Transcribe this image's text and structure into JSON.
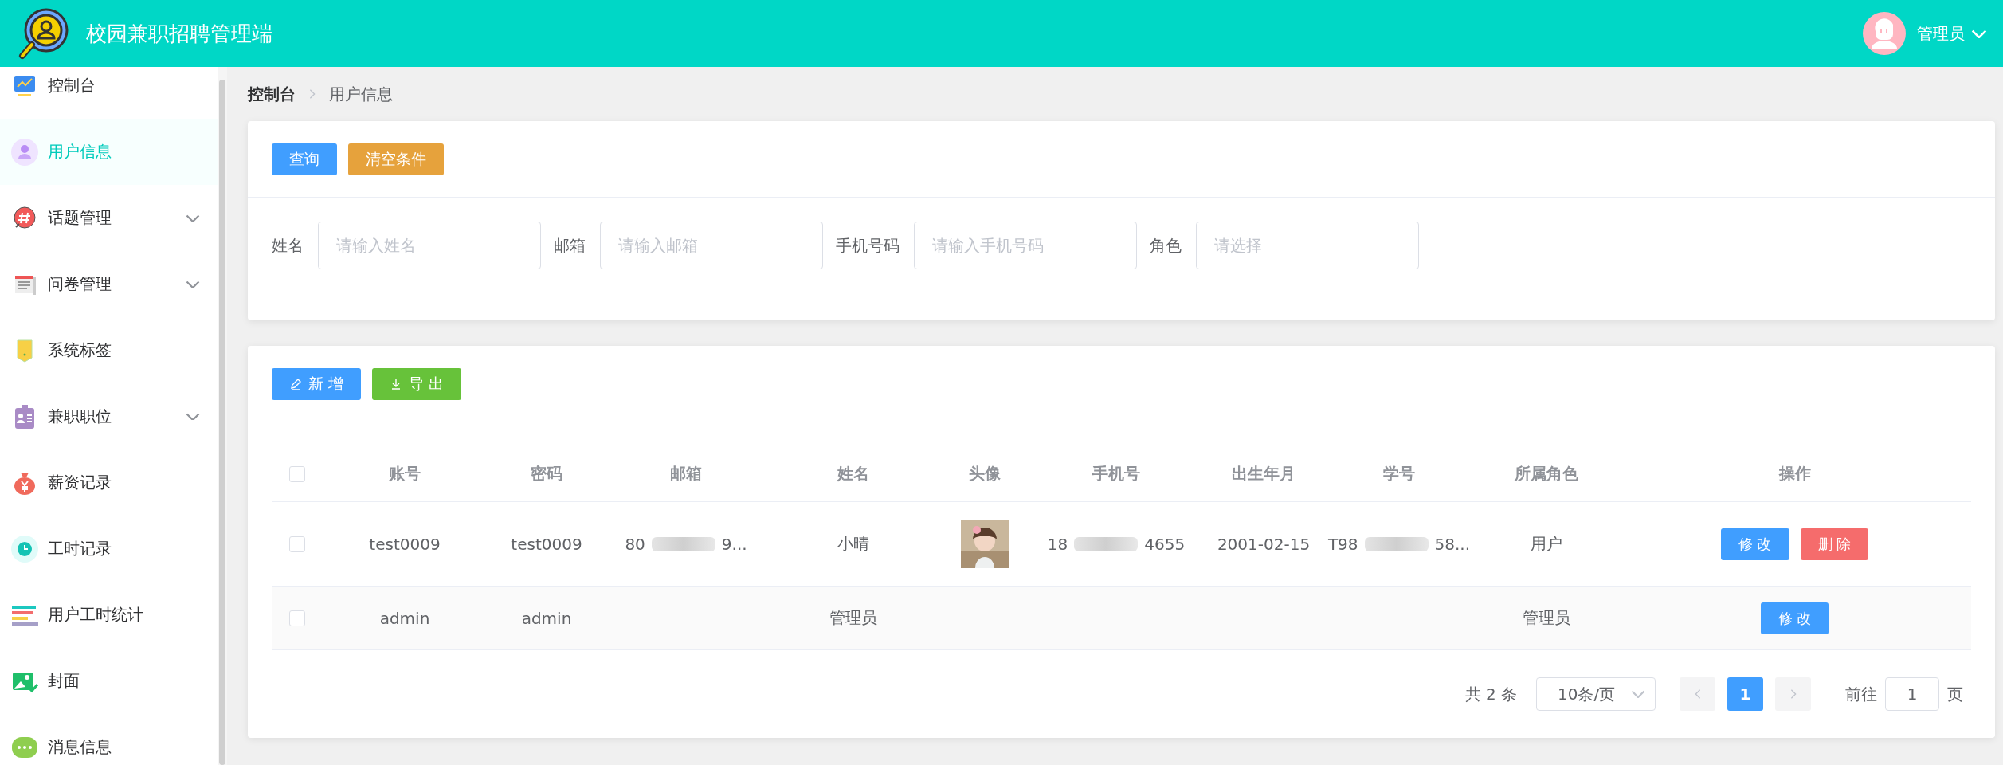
{
  "header": {
    "title": "校园兼职招聘管理端",
    "user": "管理员"
  },
  "sidebar": {
    "items": [
      {
        "label": "控制台",
        "selected": false,
        "expandable": false
      },
      {
        "label": "用户信息",
        "selected": true,
        "expandable": false
      },
      {
        "label": "话题管理",
        "selected": false,
        "expandable": true
      },
      {
        "label": "问卷管理",
        "selected": false,
        "expandable": true
      },
      {
        "label": "系统标签",
        "selected": false,
        "expandable": false
      },
      {
        "label": "兼职职位",
        "selected": false,
        "expandable": true
      },
      {
        "label": "薪资记录",
        "selected": false,
        "expandable": false
      },
      {
        "label": "工时记录",
        "selected": false,
        "expandable": false
      },
      {
        "label": "用户工时统计",
        "selected": false,
        "expandable": false
      },
      {
        "label": "封面",
        "selected": false,
        "expandable": false
      },
      {
        "label": "消息信息",
        "selected": false,
        "expandable": false
      }
    ]
  },
  "breadcrumb": [
    "控制台",
    "用户信息"
  ],
  "search_buttons": [
    {
      "label": "查询",
      "kind": "primary"
    },
    {
      "label": "清空条件",
      "kind": "warning"
    }
  ],
  "filters": [
    {
      "label": "姓名",
      "placeholder": "请输入姓名"
    },
    {
      "label": "邮箱",
      "placeholder": "请输入邮箱"
    },
    {
      "label": "手机号码",
      "placeholder": "请输入手机号码"
    },
    {
      "label": "角色",
      "placeholder": "请选择"
    }
  ],
  "toolbar": [
    {
      "label": "新 增",
      "kind": "add"
    },
    {
      "label": "导 出",
      "kind": "export"
    }
  ],
  "table": {
    "header_checked": false,
    "columns": [
      "账号",
      "密码",
      "邮箱",
      "姓名",
      "头像",
      "手机号",
      "出生年月",
      "学号",
      "所属角色",
      "操作"
    ],
    "rows": [
      {
        "checked": false,
        "account": "test0009",
        "password": "test0009",
        "email": {
          "prefix": "80",
          "suffix": "9..."
        },
        "name": "小晴",
        "phone": {
          "prefix": "18",
          "suffix": "4655"
        },
        "birth": "2001-02-15",
        "student_no": {
          "prefix": "T98",
          "suffix": "58..."
        },
        "role": "用户",
        "actions": [
          {
            "label": "修 改",
            "kind": "edit"
          },
          {
            "label": "删 除",
            "kind": "delete"
          }
        ]
      },
      {
        "checked": false,
        "account": "admin",
        "password": "admin",
        "name": "管理员",
        "role": "管理员",
        "actions": [
          {
            "label": "修 改",
            "kind": "edit"
          }
        ]
      }
    ]
  },
  "pagination": {
    "total": "共 2 条",
    "page_size": "10条/页",
    "pages": [
      {
        "label": "1",
        "selected": true
      }
    ],
    "prev_disabled": true,
    "next_disabled": true,
    "goto_label": "前往",
    "goto_value": "1",
    "goto_suffix": "页"
  }
}
